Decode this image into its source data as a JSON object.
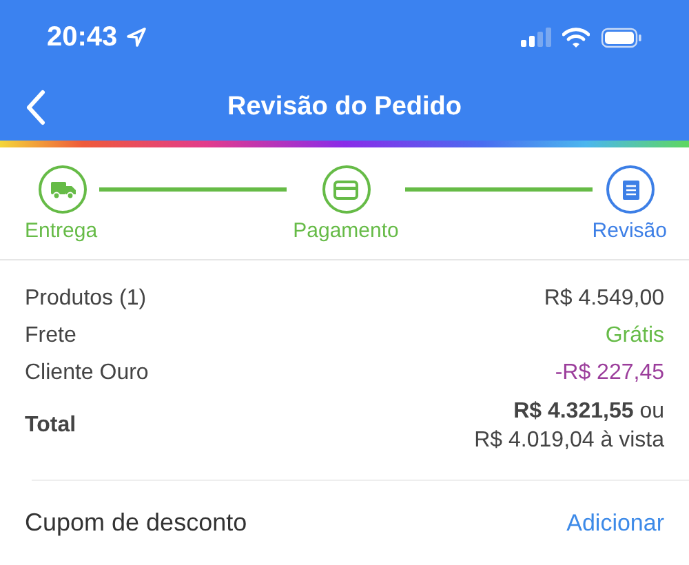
{
  "status_bar": {
    "time": "20:43"
  },
  "nav": {
    "title": "Revisão do Pedido"
  },
  "steps": [
    {
      "label": "Entrega",
      "color": "#66bb47",
      "kind": "truck"
    },
    {
      "label": "Pagamento",
      "color": "#66bb47",
      "kind": "card"
    },
    {
      "label": "Revisão",
      "color": "#3d7fe6",
      "kind": "receipt"
    }
  ],
  "summary": [
    {
      "label": "Produtos (1)",
      "value": "R$ 4.549,00",
      "color": "#444444"
    },
    {
      "label": "Frete",
      "value": "Grátis",
      "color": "#66bb47"
    },
    {
      "label": "Cliente Ouro",
      "value": "-R$ 227,45",
      "color": "#9b3d9b"
    }
  ],
  "total": {
    "label": "Total",
    "value": "**R$ 4.321,55** ou",
    "cash_value": "R$ 4.019,04 à vista"
  },
  "coupon": {
    "label": "Cupom de desconto",
    "action": "Adicionar"
  }
}
